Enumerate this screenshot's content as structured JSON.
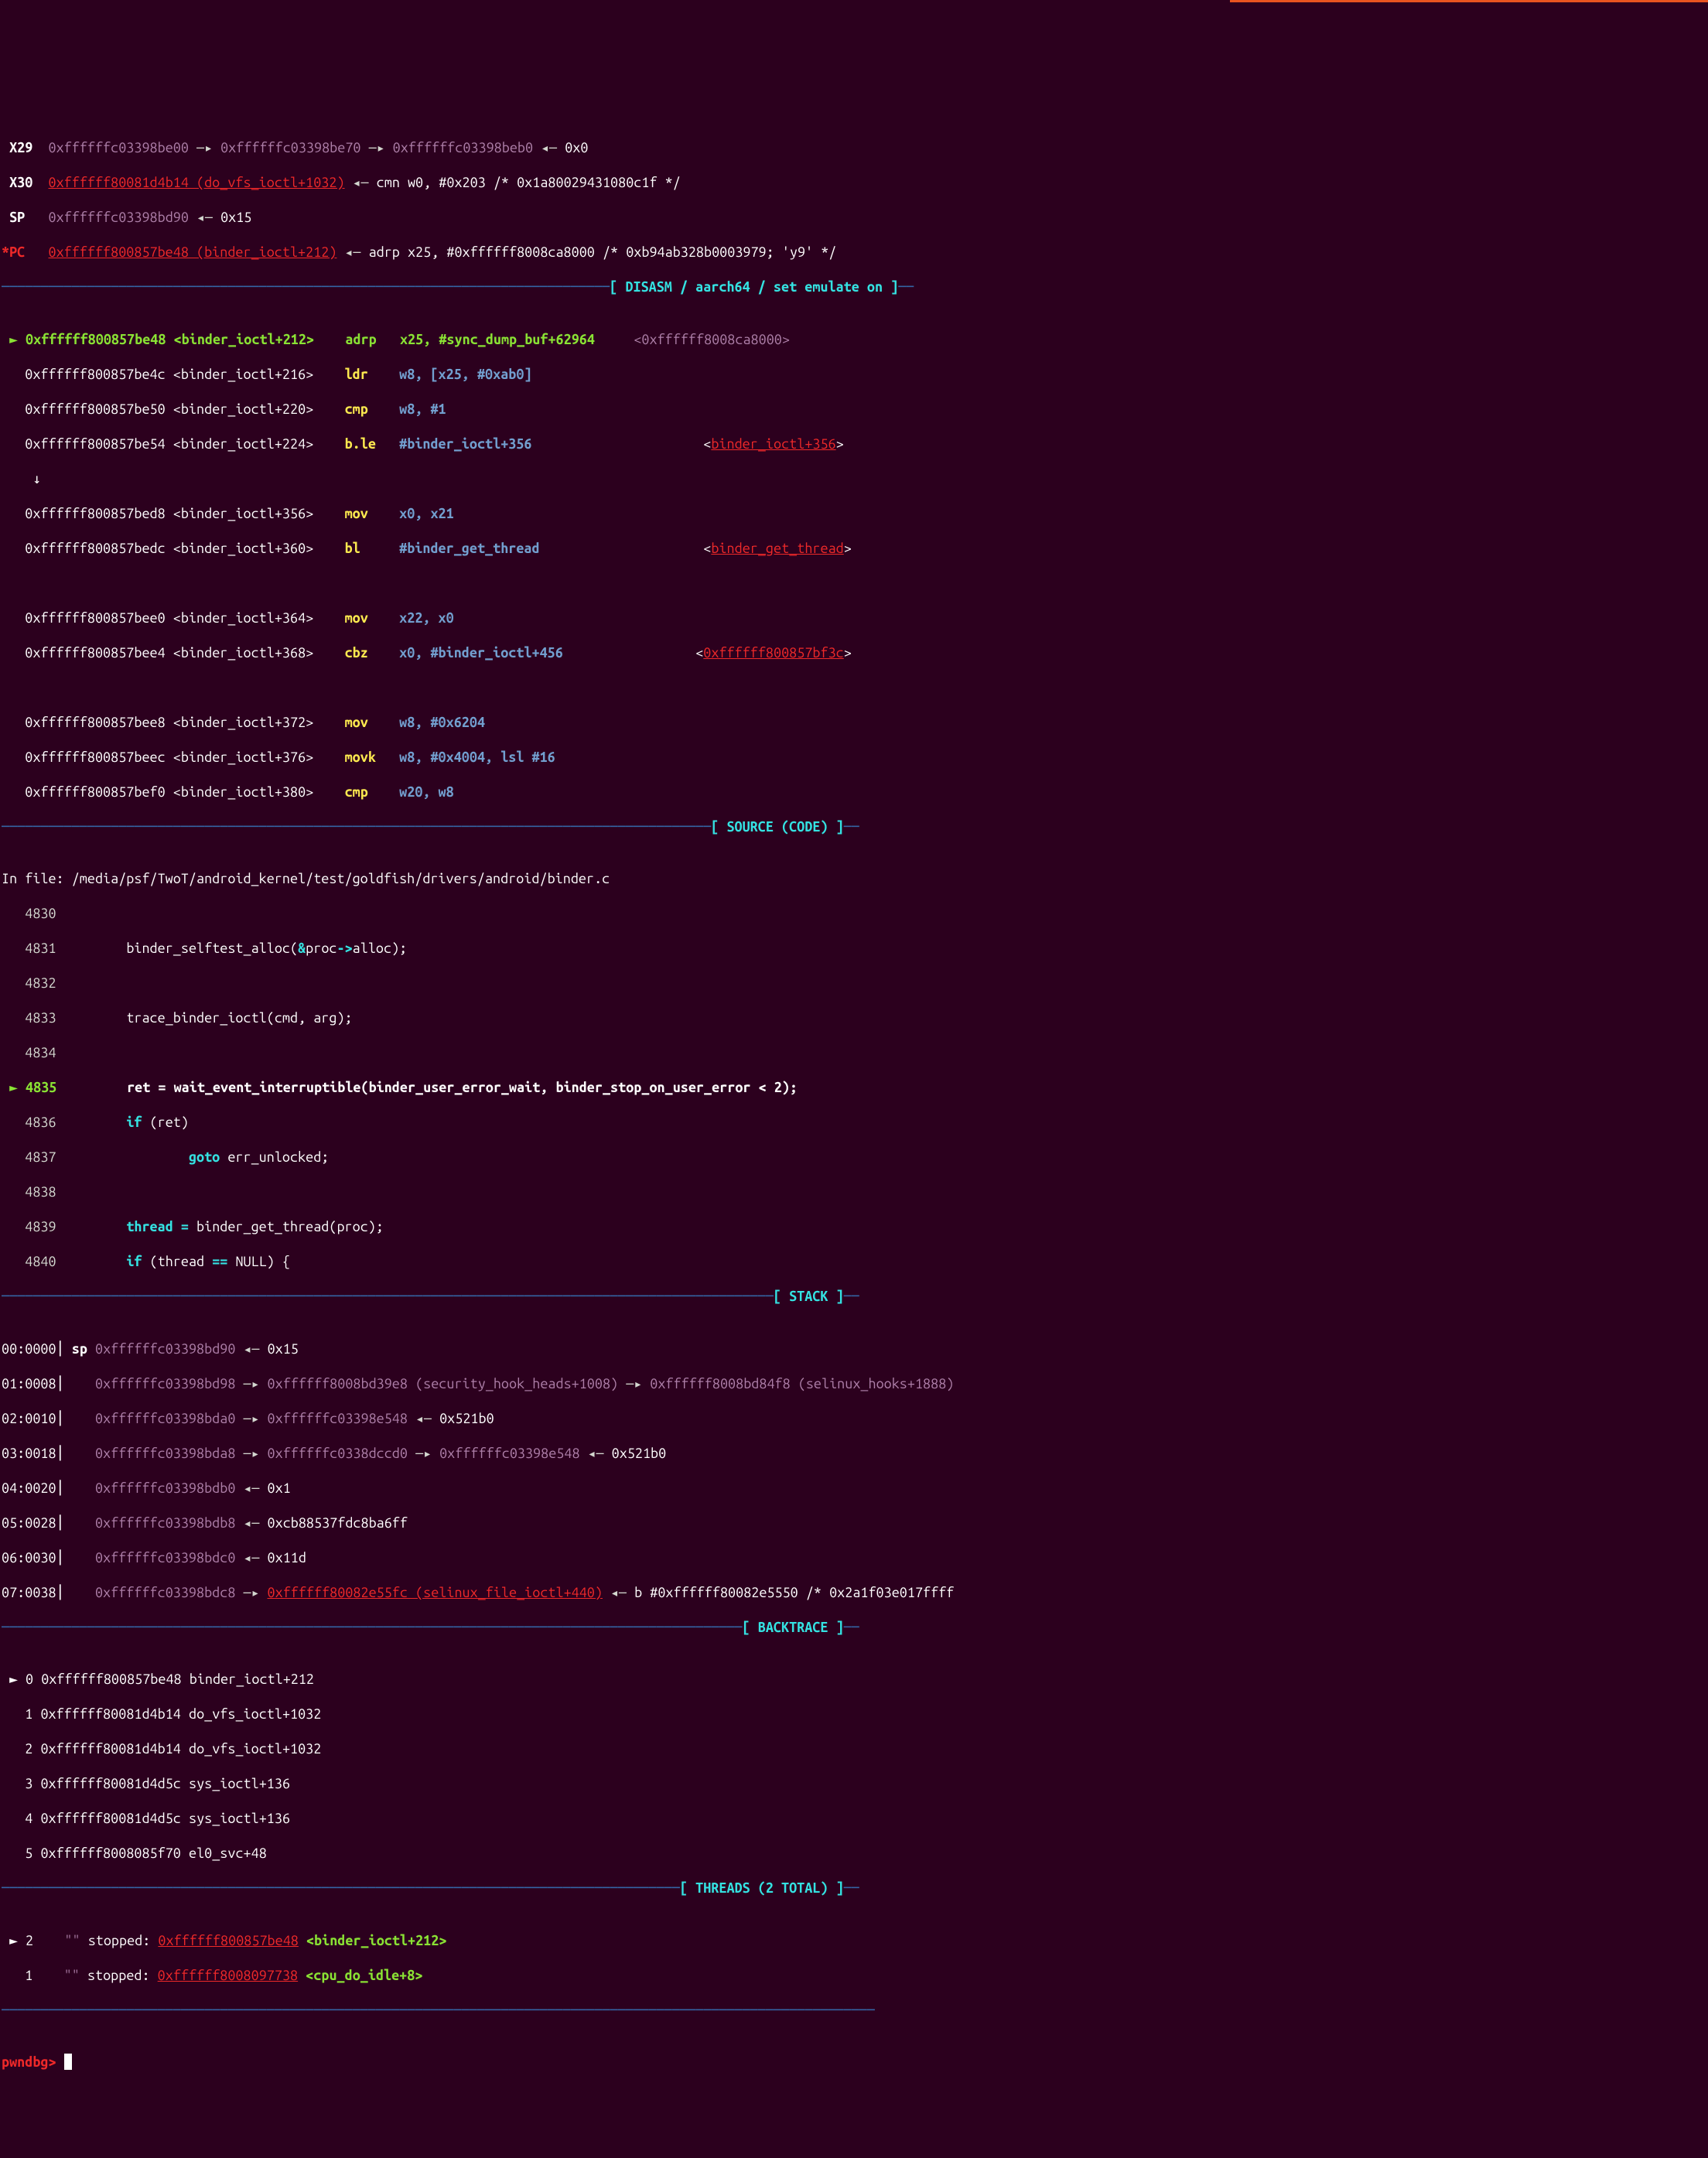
{
  "registers": {
    "x29": {
      "a": "0xffffffc03398be00",
      "b": "0xffffffc03398be70",
      "c": "0xffffffc03398beb0",
      "d": "0x0"
    },
    "x30": {
      "link": "0xffffff80081d4b14 (do_vfs_ioctl+1032)",
      "tail": "cmn w0, #0x203 /* 0x1a80029431080c1f */"
    },
    "sp": {
      "a": "0xffffffc03398bd90",
      "b": "0x15"
    },
    "pc": {
      "link": "0xffffff800857be48 (binder_ioctl+212)",
      "tail": "adrp x25, #0xffffff8008ca8000 /* 0xb94ab328b0003979; 'y9' */"
    }
  },
  "sections": {
    "disasm": "[ DISASM / aarch64 / set emulate on ]",
    "source": "[ SOURCE (CODE) ]",
    "stack": "[ STACK ]",
    "backtrace": "[ BACKTRACE ]",
    "threads": "[ THREADS (2 TOTAL) ]"
  },
  "disasm": {
    "r0": {
      "addr": "0xffffff800857be48",
      "sym": "<binder_ioctl+212>",
      "mn": "adrp",
      "op": "x25, #sync_dump_buf+62964",
      "tail": "<0xffffff8008ca8000>"
    },
    "r1": {
      "addr": "0xffffff800857be4c",
      "sym": "<binder_ioctl+216>",
      "mn": "ldr",
      "op": "w8, [x25, #0xab0]"
    },
    "r2": {
      "addr": "0xffffff800857be50",
      "sym": "<binder_ioctl+220>",
      "mn": "cmp",
      "op": "w8, #1"
    },
    "r3": {
      "addr": "0xffffff800857be54",
      "sym": "<binder_ioctl+224>",
      "mn": "b.le",
      "op": "#binder_ioctl+356",
      "link": "binder_ioctl+356"
    },
    "r4": {
      "addr": "0xffffff800857bed8",
      "sym": "<binder_ioctl+356>",
      "mn": "mov",
      "op": "x0, x21"
    },
    "r5": {
      "addr": "0xffffff800857bedc",
      "sym": "<binder_ioctl+360>",
      "mn": "bl",
      "op": "#binder_get_thread",
      "link": "binder_get_thread"
    },
    "r6": {
      "addr": "0xffffff800857bee0",
      "sym": "<binder_ioctl+364>",
      "mn": "mov",
      "op": "x22, x0"
    },
    "r7": {
      "addr": "0xffffff800857bee4",
      "sym": "<binder_ioctl+368>",
      "mn": "cbz",
      "op": "x0, #binder_ioctl+456",
      "link": "0xffffff800857bf3c"
    },
    "r8": {
      "addr": "0xffffff800857bee8",
      "sym": "<binder_ioctl+372>",
      "mn": "mov",
      "op": "w8, #0x6204"
    },
    "r9": {
      "addr": "0xffffff800857beec",
      "sym": "<binder_ioctl+376>",
      "mn": "movk",
      "op": "w8, #0x4004, lsl #16"
    },
    "r10": {
      "addr": "0xffffff800857bef0",
      "sym": "<binder_ioctl+380>",
      "mn": "cmp",
      "op": "w20, w8"
    }
  },
  "source": {
    "file": "In file: /media/psf/TwoT/android_kernel/test/goldfish/drivers/android/binder.c",
    "4830": "",
    "4831_a": "binder_selftest_alloc(",
    "4831_b": "&",
    "4831_c": "proc",
    "4831_d": "->",
    "4831_e": "alloc);",
    "4832": "",
    "4833": "trace_binder_ioctl(cmd, arg);",
    "4834": "",
    "4835": "ret = wait_event_interruptible(binder_user_error_wait, binder_stop_on_user_error < 2);",
    "4836_a": "if",
    "4836_b": " (ret)",
    "4837_a": "goto",
    "4837_b": " err_unlocked;",
    "4838": "",
    "4839_a": "thread =",
    "4839_b": " binder_get_thread(proc);",
    "4840_a": "if",
    "4840_b": " (thread ",
    "4840_c": "==",
    "4840_d": " NULL) {"
  },
  "stack": {
    "s0": {
      "off": "00:0000",
      "r": "sp",
      "a": "0xffffffc03398bd90",
      "b": "0x15"
    },
    "s1": {
      "off": "01:0008",
      "a": "0xffffffc03398bd98",
      "b": "0xffffff8008bd39e8 (security_hook_heads+1008)",
      "c": "0xffffff8008bd84f8 (selinux_hooks+1888)"
    },
    "s2": {
      "off": "02:0010",
      "a": "0xffffffc03398bda0",
      "b": "0xffffffc03398e548",
      "c": "0x521b0"
    },
    "s3": {
      "off": "03:0018",
      "a": "0xffffffc03398bda8",
      "b": "0xffffffc0338dccd0",
      "c": "0xffffffc03398e548",
      "d": "0x521b0"
    },
    "s4": {
      "off": "04:0020",
      "a": "0xffffffc03398bdb0",
      "b": "0x1"
    },
    "s5": {
      "off": "05:0028",
      "a": "0xffffffc03398bdb8",
      "b": "0xcb88537fdc8ba6ff"
    },
    "s6": {
      "off": "06:0030",
      "a": "0xffffffc03398bdc0",
      "b": "0x11d"
    },
    "s7": {
      "off": "07:0038",
      "a": "0xffffffc03398bdc8",
      "link": "0xffffff80082e55fc (selinux_file_ioctl+440)",
      "b": "b #0xffffff80082e5550 /* 0x2a1f03e017ffff"
    }
  },
  "backtrace": {
    "0": {
      "n": "0",
      "addr": "0xffffff800857be48",
      "sym": "binder_ioctl+212"
    },
    "1": {
      "n": "1",
      "addr": "0xffffff80081d4b14",
      "sym": "do_vfs_ioctl+1032"
    },
    "2": {
      "n": "2",
      "addr": "0xffffff80081d4b14",
      "sym": "do_vfs_ioctl+1032"
    },
    "3": {
      "n": "3",
      "addr": "0xffffff80081d4d5c",
      "sym": "sys_ioctl+136"
    },
    "4": {
      "n": "4",
      "addr": "0xffffff80081d4d5c",
      "sym": "sys_ioctl+136"
    },
    "5": {
      "n": "5",
      "addr": "0xffffff8008085f70",
      "sym": "el0_svc+48"
    }
  },
  "threads": {
    "t2": {
      "n": "2",
      "name": "\"\"",
      "state": "stopped:",
      "link": "0xffffff800857be48",
      "sym": "<binder_ioctl+212>"
    },
    "t1": {
      "n": "1",
      "name": "\"\"",
      "state": "stopped:",
      "link": "0xffffff8008097738",
      "sym": "<cpu_do_idle+8>"
    }
  },
  "prompt": "pwndbg> "
}
